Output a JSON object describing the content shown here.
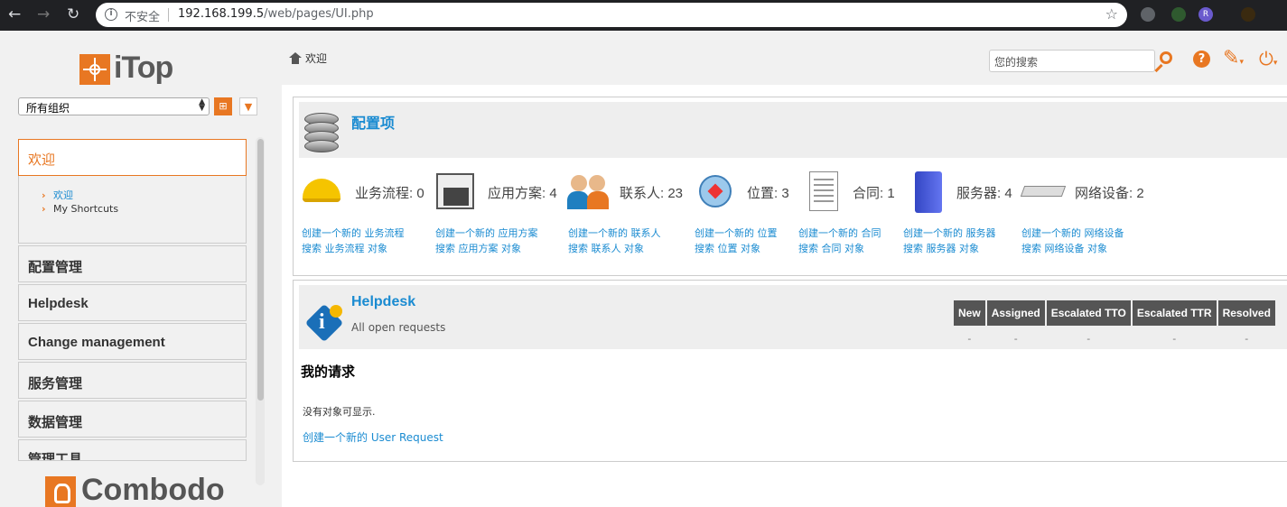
{
  "browser": {
    "insecure_label": "不安全",
    "url_host": "192.168.199.5",
    "url_path": "/web/pages/UI.php",
    "extension_label": "R"
  },
  "sidebar": {
    "logo_text": "iTop",
    "org_select_value": "所有组织",
    "menu": {
      "welcome": "欢迎",
      "welcome_sub": [
        "欢迎",
        "My Shortcuts"
      ],
      "items": [
        "配置管理",
        "Helpdesk",
        "Change management",
        "服务管理",
        "数据管理",
        "管理工具"
      ]
    },
    "footer_logo_text": "Combodo"
  },
  "topbar": {
    "breadcrumb": "欢迎",
    "search_placeholder": "您的搜索",
    "help_glyph": "?"
  },
  "ci_panel": {
    "title": "配置项",
    "classes": [
      {
        "label": "业务流程: 0",
        "create": "创建一个新的 业务流程",
        "search": "搜索 业务流程 对象",
        "icon": "hardhat-icon"
      },
      {
        "label": "应用方案: 4",
        "create": "创建一个新的 应用方案",
        "search": "搜索 应用方案 对象",
        "icon": "app-solution-icon"
      },
      {
        "label": "联系人: 23",
        "create": "创建一个新的 联系人",
        "search": "搜索 联系人 对象",
        "icon": "contacts-icon"
      },
      {
        "label": "位置: 3",
        "create": "创建一个新的 位置",
        "search": "搜索 位置 对象",
        "icon": "location-icon"
      },
      {
        "label": "合同: 1",
        "create": "创建一个新的 合同",
        "search": "搜索 合同 对象",
        "icon": "contract-icon"
      },
      {
        "label": "服务器: 4",
        "create": "创建一个新的 服务器",
        "search": "搜索 服务器 对象",
        "icon": "server-icon"
      },
      {
        "label": "网络设备: 2",
        "create": "创建一个新的 网络设备",
        "search": "搜索 网络设备 对象",
        "icon": "network-device-icon"
      }
    ]
  },
  "helpdesk_panel": {
    "title": "Helpdesk",
    "subtitle": "All open requests",
    "columns": [
      "New",
      "Assigned",
      "Escalated TTO",
      "Escalated TTR",
      "Resolved"
    ],
    "values": [
      "-",
      "-",
      "-",
      "-",
      "-"
    ],
    "my_requests_title": "我的请求",
    "no_objects": "没有对象可显示.",
    "create_request": "创建一个新的 User Request"
  }
}
